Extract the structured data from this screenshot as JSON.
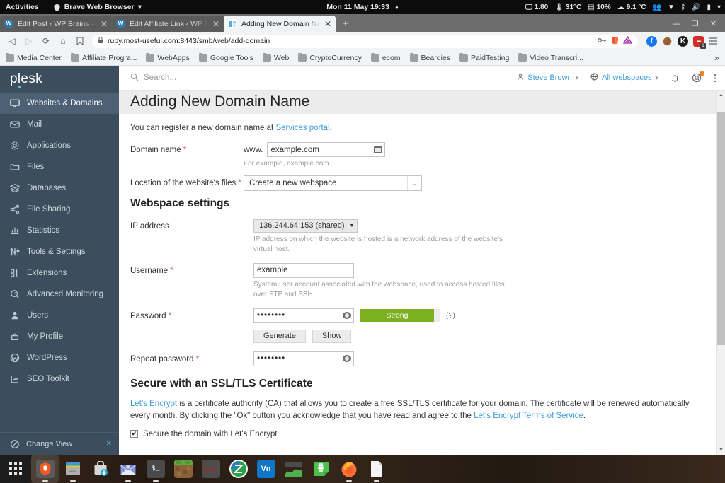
{
  "os_bar": {
    "activities": "Activities",
    "app_name": "Brave Web Browser",
    "app_caret": "▾",
    "clock": "Mon 11 May  19:33",
    "recording_dot": "●",
    "indicators": [
      {
        "icon": "monitor-icon",
        "glyph": "🖵",
        "value": "1.80"
      },
      {
        "icon": "thermometer-icon",
        "glyph": "🌡",
        "value": "31°C"
      },
      {
        "icon": "memory-icon",
        "glyph": "▤",
        "value": "10%"
      },
      {
        "icon": "weather-cloud-icon",
        "glyph": "☁",
        "value": "9.1 °C"
      }
    ],
    "tray": [
      "network-icon",
      "wifi-icon",
      "bluetooth-icon",
      "volume-icon",
      "battery-icon",
      "caret-down-icon"
    ],
    "tray_glyphs": [
      "👥",
      "▼",
      "ᛒ",
      "🔊",
      "▮",
      "▾"
    ]
  },
  "browser": {
    "tabs": [
      {
        "title": "Edit Post ‹ WP Brains — Wo",
        "favicon": "wordpress-icon",
        "active": false,
        "close": "✕"
      },
      {
        "title": "Edit Affiliate Link ‹ WP Brain",
        "favicon": "wordpress-icon",
        "active": false,
        "close": "✕"
      },
      {
        "title": "Adding New Domain Name",
        "favicon": "plesk-icon",
        "active": true,
        "close": "✕"
      }
    ],
    "new_tab_label": "+",
    "window_controls": [
      "—",
      "❐",
      "✕"
    ],
    "nav": {
      "back": "◁",
      "forward": "▷",
      "reload": "⟳",
      "home": "⌂",
      "bookmark": "🔖"
    },
    "url": "ruby.most-useful.com:8443/smb/web/add-domain",
    "lock_icon": "lock-icon",
    "omnibox_right_icons": [
      "key-icon",
      "brave-shield-icon",
      "brave-triangle-icon"
    ],
    "extensions": [
      "facebook-icon",
      "cookie-icon",
      "kaspersky-icon",
      "lastpass-icon"
    ],
    "extension_badge": "1",
    "menu_icon": "hamburger-menu-icon",
    "bookmarks": [
      "Media Center",
      "Affiliate Progra...",
      "WebApps",
      "Google Tools",
      "Web",
      "CryptoCurrency",
      "ecom",
      "Beardies",
      "PaidTesting",
      "Video Transcri..."
    ],
    "bookmarks_overflow": "»"
  },
  "plesk": {
    "logo": "plesk",
    "nav": [
      {
        "label": "Websites & Domains",
        "icon": "monitor-icon",
        "active": true
      },
      {
        "label": "Mail",
        "icon": "envelope-icon",
        "active": false
      },
      {
        "label": "Applications",
        "icon": "gear-icon",
        "active": false
      },
      {
        "label": "Files",
        "icon": "folder-icon",
        "active": false
      },
      {
        "label": "Databases",
        "icon": "database-stack-icon",
        "active": false
      },
      {
        "label": "File Sharing",
        "icon": "share-nodes-icon",
        "active": false
      },
      {
        "label": "Statistics",
        "icon": "bar-chart-icon",
        "active": false
      },
      {
        "label": "Tools & Settings",
        "icon": "sliders-icon",
        "active": false
      },
      {
        "label": "Extensions",
        "icon": "puzzle-blocks-icon",
        "active": false
      },
      {
        "label": "Advanced Monitoring",
        "icon": "magnifier-gauge-icon",
        "active": false
      },
      {
        "label": "Users",
        "icon": "user-icon",
        "active": false
      },
      {
        "label": "My Profile",
        "icon": "id-badge-icon",
        "active": false
      },
      {
        "label": "WordPress",
        "icon": "wordpress-icon",
        "active": false
      },
      {
        "label": "SEO Toolkit",
        "icon": "trend-arrow-icon",
        "active": false
      }
    ],
    "change_view": "Change View",
    "change_view_close": "✕",
    "collapse_handle": "❮",
    "topbar": {
      "search_placeholder": "Search...",
      "search_icon": "search-icon",
      "user": "Steve Brown",
      "user_caret": "▾",
      "webspaces": "All webspaces",
      "webspaces_caret": "▾",
      "bell_icon": "bell-icon",
      "support_icon": "lifebuoy-icon",
      "more_icon": "kebab-menu-icon"
    },
    "page_title": "Adding New Domain Name",
    "intro_prefix": "You can register a new domain name at ",
    "intro_link": "Services portal",
    "intro_suffix": ".",
    "fields": {
      "domain_label": "Domain name",
      "domain_prefix": "www.",
      "domain_value": "example.com",
      "domain_hint": "For example, example.com",
      "location_label": "Location of the website's files",
      "location_value": "Create a new webspace",
      "location_caret": "⌄",
      "webspace_heading": "Webspace settings",
      "ip_label": "IP address",
      "ip_value": "136.244.64.153 (shared)",
      "ip_caret": "▼",
      "ip_hint": "IP address on which the website is hosted is a network address of the website's virtual host.",
      "username_label": "Username",
      "username_value": "example",
      "username_hint": "System user account associated with the webspace, used to access hosted files over FTP and SSH.",
      "password_label": "Password",
      "password_value": "••••••••",
      "password_strength": "Strong",
      "password_strength_color": "#7cb021",
      "password_help": "(?)",
      "generate_button": "Generate",
      "show_button": "Show",
      "repeat_label": "Repeat password",
      "repeat_value": "••••••••"
    },
    "ssl": {
      "heading": "Secure with an SSL/TLS Certificate",
      "link1": "Let's Encrypt",
      "text1": " is a certificate authority (CA) that allows you to create a free SSL/TLS certificate for your domain. The certificate will be renewed automatically every month. By clicking the \"Ok\" button you acknowledge that you have read and agree to the ",
      "link2": "Let's Encrypt Terms of Service",
      "text2": ".",
      "checkbox_label": "Secure the domain with Let's Encrypt",
      "checkbox_mark": "✔",
      "checkbox_checked": true
    },
    "scroll_up": "▲",
    "scroll_down": "▼"
  },
  "dock": {
    "apps_icon": "app-grid-icon",
    "items": [
      {
        "name": "brave-browser",
        "glyph": "🦁",
        "selected": true,
        "running": true
      },
      {
        "name": "file-manager",
        "glyph": "▤",
        "selected": false,
        "running": true
      },
      {
        "name": "software-installer",
        "glyph": "⬇",
        "selected": false,
        "running": false
      },
      {
        "name": "mail-client",
        "glyph": "✉",
        "selected": false,
        "running": true
      },
      {
        "name": "terminal",
        "glyph": "$_",
        "selected": false,
        "running": true
      },
      {
        "name": "minecraft",
        "glyph": "",
        "selected": false,
        "running": false
      },
      {
        "name": "vm-manager",
        "glyph": "VM",
        "selected": false,
        "running": false
      },
      {
        "name": "zotero",
        "glyph": "Z",
        "selected": false,
        "running": false
      },
      {
        "name": "vnc-viewer",
        "glyph": "Vn",
        "selected": false,
        "running": false
      },
      {
        "name": "charts-app",
        "glyph": "▰",
        "selected": false,
        "running": false
      },
      {
        "name": "sticky-notes",
        "glyph": "#",
        "selected": false,
        "running": false
      },
      {
        "name": "firefox",
        "glyph": "🦊",
        "selected": false,
        "running": true
      },
      {
        "name": "text-document",
        "glyph": "📄",
        "selected": false,
        "running": true
      }
    ]
  },
  "colors": {
    "plesk_sidebar": "#3c4d5d",
    "accent_blue": "#3c9cd7",
    "required_red": "#e2576d",
    "strength_green": "#7cb021"
  }
}
